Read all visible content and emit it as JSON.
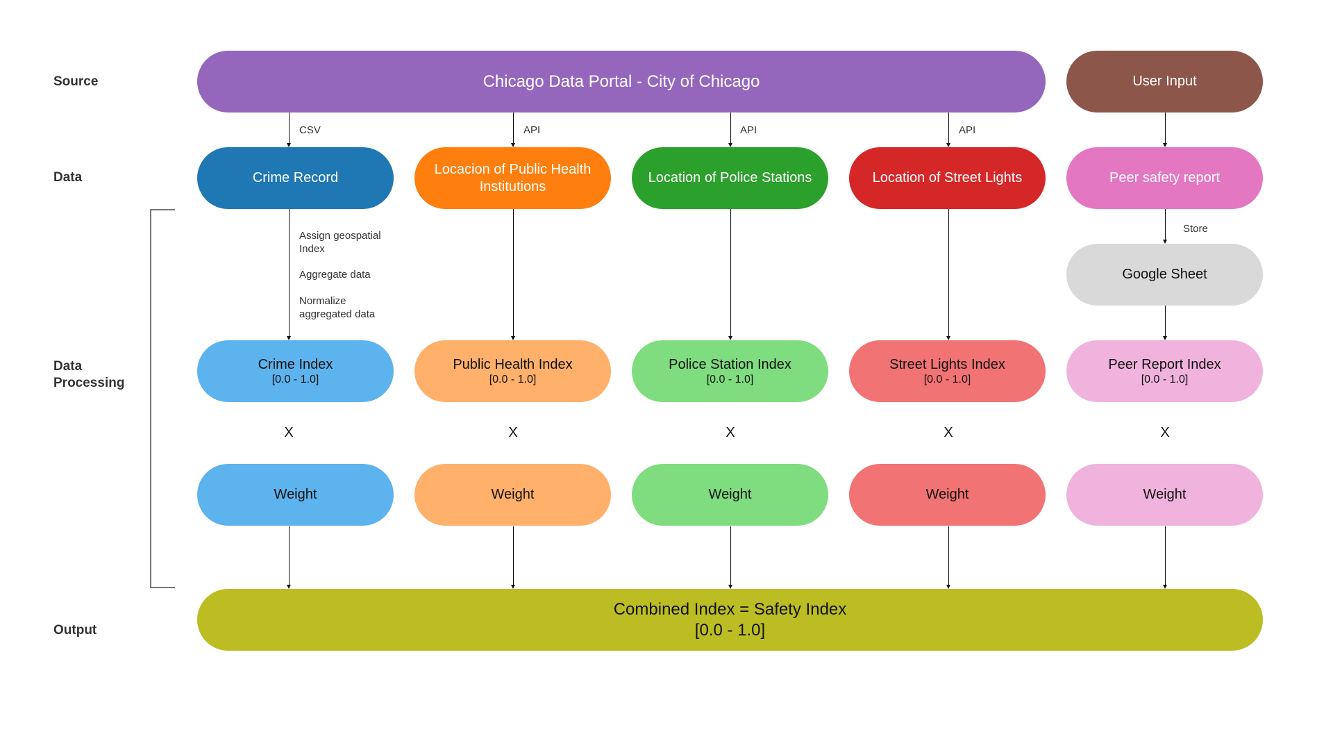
{
  "row_labels": {
    "source": "Source",
    "data": "Data",
    "processing": "Data\nProcessing",
    "output": "Output"
  },
  "source": {
    "chicago": {
      "label": "Chicago Data Portal - City of Chicago",
      "color": "#9467bd"
    },
    "user_input": {
      "label": "User Input",
      "color": "#8c564b"
    }
  },
  "edges": {
    "crime": "CSV",
    "health": "API",
    "police": "API",
    "lights": "API",
    "store": "Store"
  },
  "crime_steps": [
    "Assign geospatial\nIndex",
    "Aggregate data",
    "Normalize\naggregated data"
  ],
  "data_nodes": [
    {
      "label": "Crime Record",
      "color": "#1f77b4"
    },
    {
      "label": "Locacion of Public Health Institutions",
      "color": "#ff7f0e"
    },
    {
      "label": "Location of Police Stations",
      "color": "#2ca02c"
    },
    {
      "label": "Location of Street Lights",
      "color": "#d62728"
    },
    {
      "label": "Peer safety report",
      "color": "#e377c2"
    }
  ],
  "google_sheet": {
    "label": "Google Sheet",
    "color": "#d9d9d9"
  },
  "index_nodes": [
    {
      "label": "Crime Index",
      "range": "[0.0 - 1.0]",
      "color": "#5db3ed"
    },
    {
      "label": "Public Health Index",
      "range": "[0.0 - 1.0]",
      "color": "#ffb06b"
    },
    {
      "label": "Police Station Index",
      "range": "[0.0 - 1.0]",
      "color": "#7fdc7f"
    },
    {
      "label": "Street Lights Index",
      "range": "[0.0 - 1.0]",
      "color": "#f27373"
    },
    {
      "label": "Peer Report Index",
      "range": "[0.0 - 1.0]",
      "color": "#f0b3dd"
    }
  ],
  "operator": "X",
  "weight_nodes": [
    {
      "label": "Weight",
      "color": "#5db3ed"
    },
    {
      "label": "Weight",
      "color": "#ffb06b"
    },
    {
      "label": "Weight",
      "color": "#7fdc7f"
    },
    {
      "label": "Weight",
      "color": "#f27373"
    },
    {
      "label": "Weight",
      "color": "#f0b3dd"
    }
  ],
  "output": {
    "label": "Combined Index = Safety Index",
    "range": "[0.0 - 1.0]",
    "color": "#bcbd22"
  }
}
